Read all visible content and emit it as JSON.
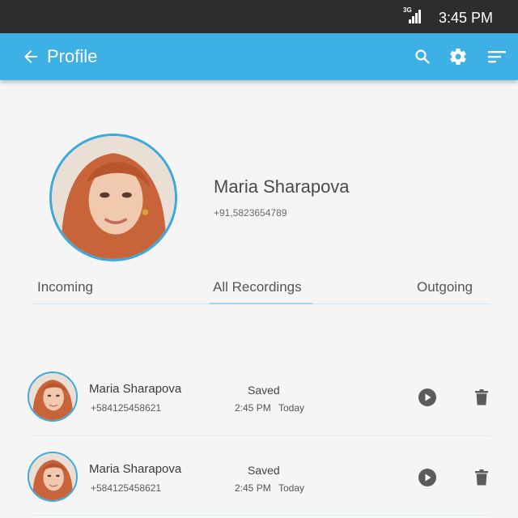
{
  "status_bar": {
    "network_label": "3G",
    "time": "3:45 PM"
  },
  "app_bar": {
    "title": "Profile",
    "icons": [
      "back-arrow-icon",
      "search-icon",
      "gear-icon",
      "sort-icon"
    ],
    "background_color": "#3db0e6"
  },
  "profile": {
    "name": "Maria Sharapova",
    "phone": "+91,5823654789"
  },
  "tabs": [
    {
      "label": "Incoming",
      "active": false
    },
    {
      "label": "All Recordings",
      "active": true
    },
    {
      "label": "Outgoing",
      "active": false
    }
  ],
  "recordings": [
    {
      "name": "Maria Sharapova",
      "phone": "+584125458621",
      "status": "Saved",
      "time": "2:45 PM",
      "day": "Today"
    },
    {
      "name": "Maria Sharapova",
      "phone": "+584125458621",
      "status": "Saved",
      "time": "2:45 PM",
      "day": "Today"
    }
  ],
  "colors": {
    "accent": "#3db0e6",
    "status_bar": "#2d2d2d",
    "avatar_ring": "#3aa9df"
  }
}
